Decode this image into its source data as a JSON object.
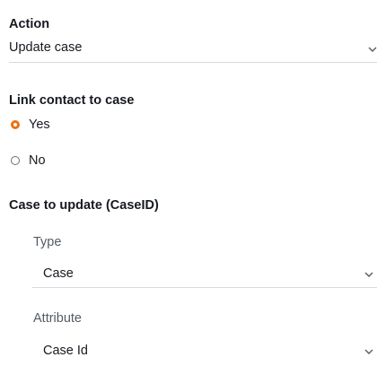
{
  "action": {
    "label": "Action",
    "value": "Update case"
  },
  "link_contact": {
    "label": "Link contact to case",
    "options": [
      {
        "label": "Yes",
        "selected": true
      },
      {
        "label": "No",
        "selected": false
      }
    ]
  },
  "case_to_update": {
    "label": "Case to update (CaseID)",
    "type": {
      "label": "Type",
      "value": "Case"
    },
    "attribute": {
      "label": "Attribute",
      "value": "Case Id"
    }
  },
  "colors": {
    "accent": "#ec7211",
    "divider": "#d5dbdb",
    "muted": "#545b64"
  }
}
